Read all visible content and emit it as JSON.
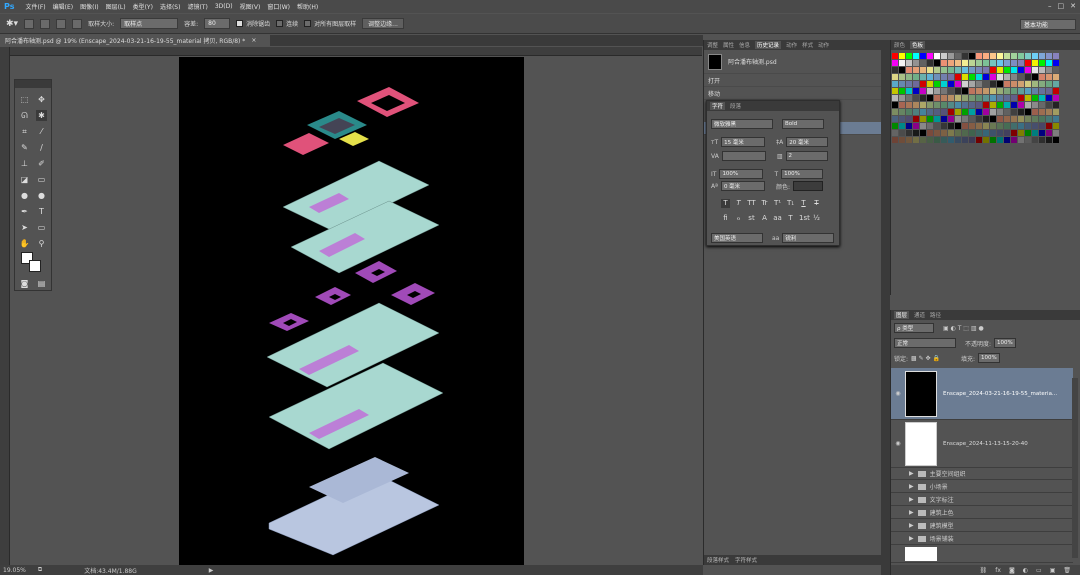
{
  "app": {
    "logo": "Ps"
  },
  "menu": [
    "文件(F)",
    "编辑(E)",
    "图像(I)",
    "图层(L)",
    "类型(Y)",
    "选择(S)",
    "滤镜(T)",
    "3D(D)",
    "视图(V)",
    "窗口(W)",
    "帮助(H)"
  ],
  "window_controls": [
    "–",
    "□",
    "✕"
  ],
  "options": {
    "sample_size_label": "取样大小:",
    "sample_size_value": "取样点",
    "tolerance_label": "容差:",
    "tolerance_value": "80",
    "antialias_label": "消除锯齿",
    "contiguous_label": "连续",
    "all_layers_label": "对所有图层取样",
    "refine_button": "调整边缘...",
    "workspace": "基本功能"
  },
  "document": {
    "tab_title": "阿合潘布轴测.psd @ 19% (Enscape_2024-03-21-16-19-55_material 拷贝, RGB/8) *",
    "tab_close": "×"
  },
  "status": {
    "zoom": "19.05%",
    "doc_label": "文档:43.4M/1.88G"
  },
  "history_panel": {
    "tabs": [
      "调整",
      "属性",
      "信息",
      "历史记录",
      "动作",
      "样式",
      "动作"
    ],
    "snapshot_name": "阿合潘布轴测.psd",
    "rows": [
      "打开",
      "移动"
    ]
  },
  "character_panel": {
    "tabs": [
      "字符",
      "段落"
    ],
    "font_family": "微软雅黑",
    "font_style": "Bold",
    "font_size": "15 毫米",
    "leading": "20 毫米",
    "tracking": "2",
    "vscale": "100%",
    "hscale": "100%",
    "baseline": "0 毫米",
    "color_label": "颜色:",
    "style_buttons": [
      "T",
      "T",
      "TT",
      "Tr",
      "T¹",
      "T₁",
      "T",
      "T"
    ],
    "ot_buttons": [
      "fi",
      "ℴ",
      "st",
      "A",
      "aa",
      "T",
      "1st",
      "½"
    ],
    "language": "美国英语",
    "antialias": "锐利",
    "aa_label": "aa"
  },
  "swatches_panel": {
    "tabs": [
      "颜色",
      "色板"
    ]
  },
  "layers_panel": {
    "tabs": [
      "图层",
      "通道",
      "路径"
    ],
    "kind_filter": "ρ 类型",
    "blend_mode": "正常",
    "opacity_label": "不透明度:",
    "opacity_value": "100%",
    "lock_label": "锁定:",
    "fill_label": "填充:",
    "fill_value": "100%",
    "layers": [
      {
        "name": "Enscape_2024-03-21-16-19-55_materia...",
        "type": "image",
        "selected": true
      },
      {
        "name": "Enscape_2024-11-13-15-20-40",
        "type": "image",
        "selected": false
      },
      {
        "name": "主要空间组织",
        "type": "group"
      },
      {
        "name": "小场景",
        "type": "group"
      },
      {
        "name": "文字标注",
        "type": "group"
      },
      {
        "name": "建筑上色",
        "type": "group"
      },
      {
        "name": "建筑模型",
        "type": "group"
      },
      {
        "name": "场景铺装",
        "type": "group"
      }
    ]
  },
  "bottom_tabs": [
    "段落样式",
    "字符样式"
  ],
  "colors": {
    "accent_selection": "#6b7c93",
    "ps_blue": "#31a8ff"
  }
}
